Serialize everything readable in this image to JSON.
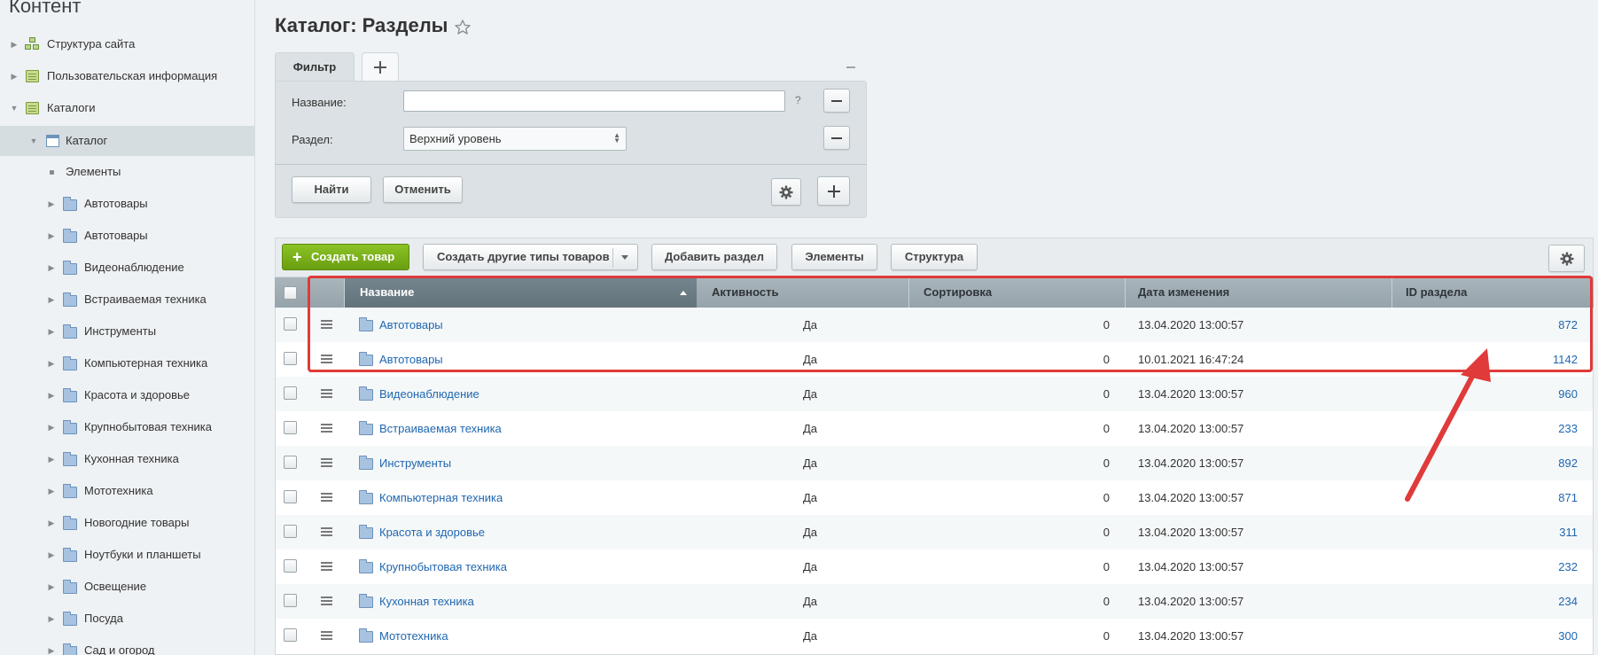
{
  "sidebar": {
    "title": "Контент",
    "items": [
      {
        "label": "Структура сайта"
      },
      {
        "label": "Пользовательская информация"
      },
      {
        "label": "Каталоги"
      },
      {
        "label": "Каталог"
      },
      {
        "label": "Элементы"
      },
      {
        "label": "Автотовары"
      },
      {
        "label": "Автотовары"
      },
      {
        "label": "Видеонаблюдение"
      },
      {
        "label": "Встраиваемая техника"
      },
      {
        "label": "Инструменты"
      },
      {
        "label": "Компьютерная техника"
      },
      {
        "label": "Красота и здоровье"
      },
      {
        "label": "Крупнобытовая техника"
      },
      {
        "label": "Кухонная техника"
      },
      {
        "label": "Мототехника"
      },
      {
        "label": "Новогодние товары"
      },
      {
        "label": "Ноутбуки и планшеты"
      },
      {
        "label": "Освещение"
      },
      {
        "label": "Посуда"
      },
      {
        "label": "Сад и огород"
      }
    ]
  },
  "page": {
    "title": "Каталог: Разделы"
  },
  "filter": {
    "tab_label": "Фильтр",
    "name_label": "Название:",
    "name_value": "",
    "help": "?",
    "section_label": "Раздел:",
    "section_value": "Верхний уровень",
    "find_button": "Найти",
    "cancel_button": "Отменить"
  },
  "toolbar": {
    "create_product": "Создать товар",
    "create_other": "Создать другие типы товаров",
    "add_section": "Добавить раздел",
    "elements": "Элементы",
    "structure": "Структура"
  },
  "table": {
    "columns": [
      "Название",
      "Активность",
      "Сортировка",
      "Дата изменения",
      "ID раздела"
    ],
    "rows": [
      {
        "name": "Автотовары",
        "active": "Да",
        "sort": "0",
        "date": "13.04.2020 13:00:57",
        "id": "872"
      },
      {
        "name": "Автотовары",
        "active": "Да",
        "sort": "0",
        "date": "10.01.2021 16:47:24",
        "id": "1142"
      },
      {
        "name": "Видеонаблюдение",
        "active": "Да",
        "sort": "0",
        "date": "13.04.2020 13:00:57",
        "id": "960"
      },
      {
        "name": "Встраиваемая техника",
        "active": "Да",
        "sort": "0",
        "date": "13.04.2020 13:00:57",
        "id": "233"
      },
      {
        "name": "Инструменты",
        "active": "Да",
        "sort": "0",
        "date": "13.04.2020 13:00:57",
        "id": "892"
      },
      {
        "name": "Компьютерная техника",
        "active": "Да",
        "sort": "0",
        "date": "13.04.2020 13:00:57",
        "id": "871"
      },
      {
        "name": "Красота и здоровье",
        "active": "Да",
        "sort": "0",
        "date": "13.04.2020 13:00:57",
        "id": "311"
      },
      {
        "name": "Крупнобытовая техника",
        "active": "Да",
        "sort": "0",
        "date": "13.04.2020 13:00:57",
        "id": "232"
      },
      {
        "name": "Кухонная техника",
        "active": "Да",
        "sort": "0",
        "date": "13.04.2020 13:00:57",
        "id": "234"
      },
      {
        "name": "Мототехника",
        "active": "Да",
        "sort": "0",
        "date": "13.04.2020 13:00:57",
        "id": "300"
      }
    ]
  },
  "colors": {
    "accent_green": "#7ab51d",
    "link_blue": "#2067b0",
    "annotation_red": "#e03a3a"
  }
}
